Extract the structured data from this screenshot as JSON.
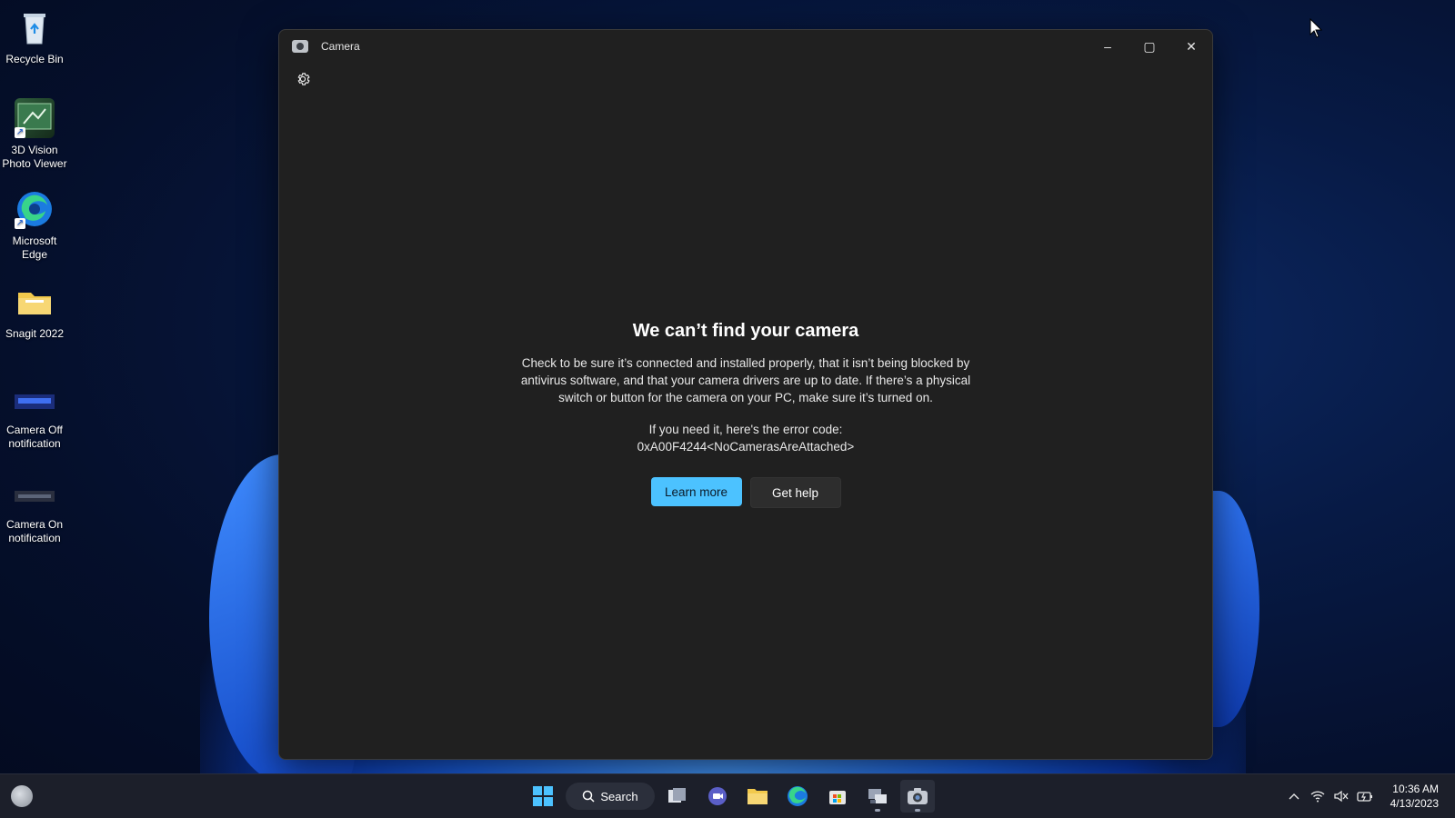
{
  "desktop": {
    "icons": [
      {
        "label": "Recycle Bin"
      },
      {
        "label": "3D Vision Photo Viewer"
      },
      {
        "label": "Microsoft Edge"
      },
      {
        "label": "Snagit 2022"
      },
      {
        "label": "Camera Off notification"
      },
      {
        "label": "Camera On notification"
      }
    ]
  },
  "window": {
    "title": "Camera",
    "controls": {
      "minimize": "–",
      "maximize": "▢",
      "close": "✕"
    }
  },
  "content": {
    "heading": "We can’t find your camera",
    "body": "Check to be sure it’s connected and installed properly, that it isn’t being blocked by antivirus software, and that your camera drivers are up to date. If there’s a physical switch or button for the camera on your PC, make sure it’s turned on.",
    "error_intro": "If you need it, here's the error code:",
    "error_code": "0xA00F4244<NoCamerasAreAttached>",
    "primary_button": "Learn more",
    "secondary_button": "Get help"
  },
  "taskbar": {
    "search_label": "Search",
    "time": "10:36 AM",
    "date": "4/13/2023"
  },
  "colors": {
    "accent": "#4cc2ff",
    "window_bg": "#202020",
    "taskbar_bg": "#1c1f2a"
  }
}
